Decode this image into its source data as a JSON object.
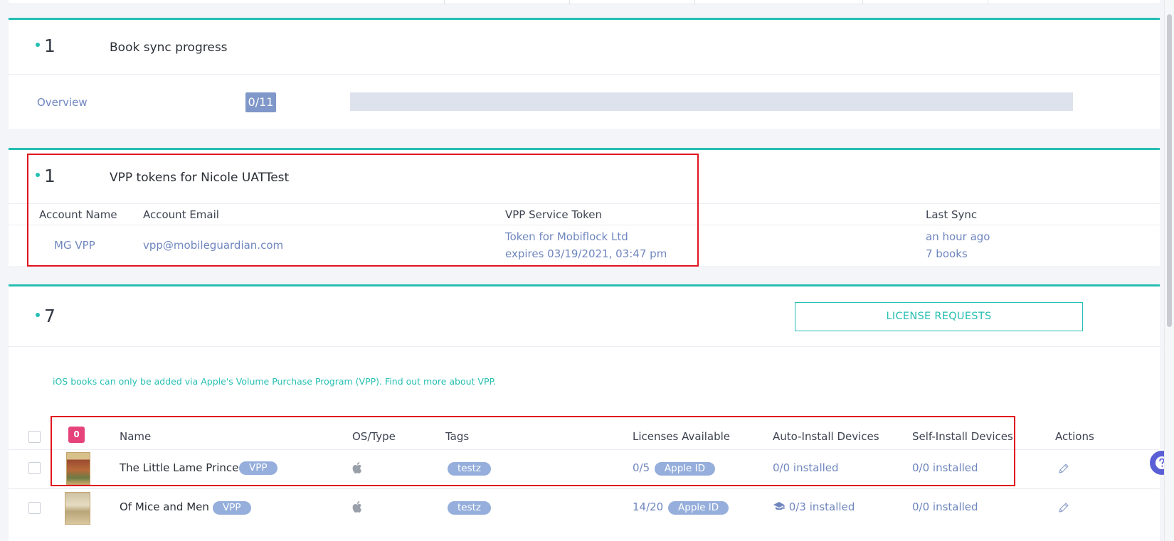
{
  "sync_card": {
    "count": "1",
    "title": "Book sync progress",
    "overview_label": "Overview",
    "progress_text": "0/11",
    "progress_fraction": 0
  },
  "vpp_card": {
    "count": "1",
    "title": "VPP tokens for Nicole UATTest",
    "headers": {
      "account_name": "Account Name",
      "account_email": "Account Email",
      "service_token": "VPP Service Token",
      "last_sync": "Last Sync"
    },
    "row": {
      "account_name": "MG VPP",
      "account_email": "vpp@mobileguardian.com",
      "token_name": "Token for Mobiflock Ltd",
      "token_expiry": "expires 03/19/2021, 03:47 pm",
      "last_sync": "an hour ago",
      "books": "7 books"
    }
  },
  "books_card": {
    "count": "7",
    "license_requests_label": "LICENSE REQUESTS",
    "info_text": "iOS books can only be added via Apple's Volume Purchase Program (VPP).",
    "info_link": "Find out more about VPP.",
    "selected_count": "0",
    "headers": {
      "name": "Name",
      "os_type": "OS/Type",
      "tags": "Tags",
      "licenses": "Licenses Available",
      "auto_install": "Auto-Install Devices",
      "self_install": "Self-Install Devices",
      "actions": "Actions"
    },
    "rows": [
      {
        "name": "The Little Lame Prince",
        "type_badge": "VPP",
        "os_icon": "apple-icon",
        "tag": "testz",
        "licenses": "0/5",
        "license_badge": "Apple ID",
        "auto_install": "0/0 installed",
        "self_install": "0/0 installed",
        "action_icon": "pencil-icon"
      },
      {
        "name": "Of Mice and Men",
        "type_badge": "VPP",
        "os_icon": "apple-icon",
        "tag": "testz",
        "licenses": "14/20",
        "license_badge": "Apple ID",
        "auto_install_icon": "graduation-cap-icon",
        "auto_install": "0/3 installed",
        "self_install": "0/0 installed",
        "action_icon": "pencil-icon"
      }
    ]
  },
  "colors": {
    "accent": "#25bfb2",
    "link": "#6f86be",
    "badge": "#95aedb",
    "highlight_box": "#e0141e",
    "counter_badge": "#e6437a"
  }
}
